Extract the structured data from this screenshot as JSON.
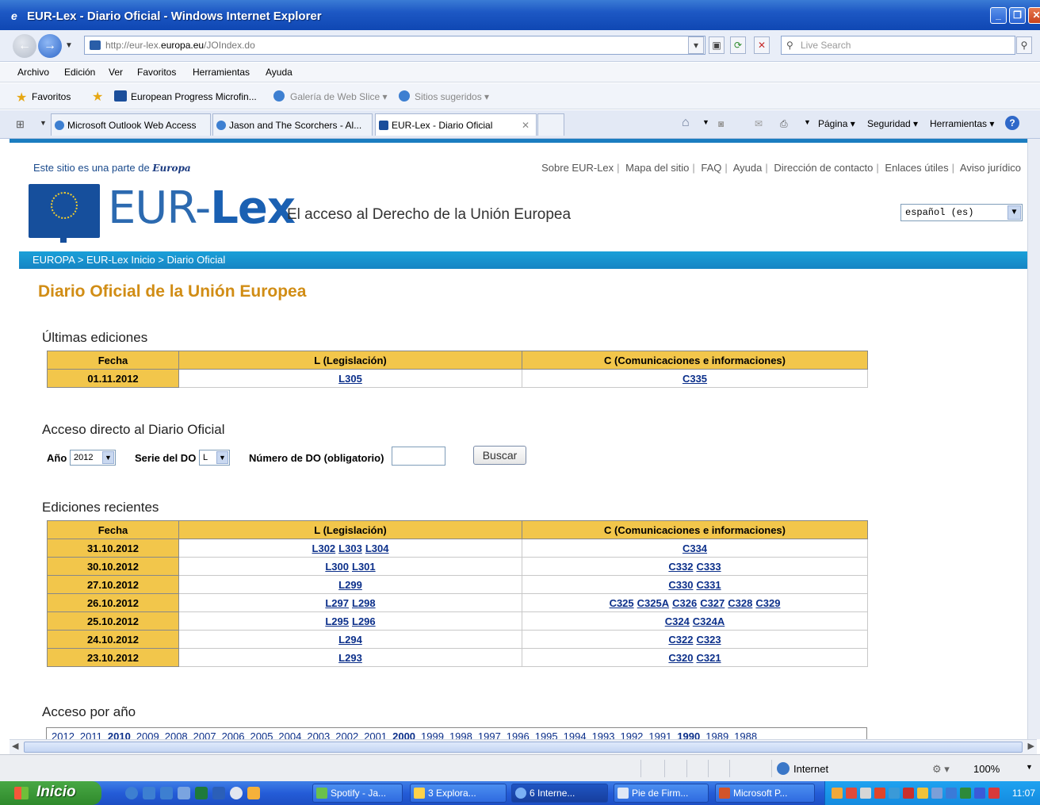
{
  "window": {
    "title": "EUR-Lex - Diario Oficial - Windows Internet Explorer"
  },
  "address": {
    "url_prefix": "http://eur-lex.",
    "url_domain": "europa.eu",
    "url_path": "/JOIndex.do",
    "search_placeholder": "Live Search"
  },
  "menu": [
    "Archivo",
    "Edición",
    "Ver",
    "Favoritos",
    "Herramientas",
    "Ayuda"
  ],
  "favorites": {
    "label": "Favoritos",
    "items": [
      "European Progress Microfin...",
      "Galería de Web Slice ▾",
      "Sitios sugeridos ▾"
    ]
  },
  "tabs": [
    {
      "label": "Microsoft Outlook Web Access"
    },
    {
      "label": "Jason and The Scorchers - Al..."
    },
    {
      "label": "EUR-Lex - Diario Oficial"
    }
  ],
  "commandbar": {
    "pagina": "Página ▾",
    "seguridad": "Seguridad ▾",
    "herramientas": "Herramientas ▾"
  },
  "site": {
    "partof": "Este sitio es una parte de",
    "partof_logo": "Europa",
    "toplinks": [
      "Sobre EUR-Lex",
      "Mapa del sitio",
      "FAQ",
      "Ayuda",
      "Dirección de contacto",
      "Enlaces útiles",
      "Aviso jurídico"
    ],
    "logo_thin": "EUR-",
    "logo_bold": "Lex",
    "tagline": "El acceso al Derecho de la Unión Europea",
    "language": "español (es)",
    "breadcrumb": "EUROPA > EUR-Lex Inicio > Diario Oficial"
  },
  "main": {
    "title": "Diario Oficial de la Unión Europea",
    "latest": {
      "heading": "Últimas ediciones",
      "headers": [
        "Fecha",
        "L (Legislación)",
        "C (Comunicaciones e informaciones)"
      ],
      "date": "01.11.2012",
      "l": "L305",
      "c": "C335"
    },
    "direct": {
      "heading": "Acceso directo al Diario Oficial",
      "year_label": "Año",
      "year_value": "2012",
      "series_label": "Serie del DO",
      "series_value": "L",
      "number_label": "Número de DO (obligatorio)",
      "number_value": "",
      "button": "Buscar"
    },
    "recent": {
      "heading": "Ediciones recientes",
      "headers": [
        "Fecha",
        "L (Legislación)",
        "C (Comunicaciones e informaciones)"
      ],
      "rows": [
        {
          "date": "31.10.2012",
          "l": [
            "L302",
            "L303",
            "L304"
          ],
          "c": [
            "C334"
          ]
        },
        {
          "date": "30.10.2012",
          "l": [
            "L300",
            "L301"
          ],
          "c": [
            "C332",
            "C333"
          ]
        },
        {
          "date": "27.10.2012",
          "l": [
            "L299"
          ],
          "c": [
            "C330",
            "C331"
          ]
        },
        {
          "date": "26.10.2012",
          "l": [
            "L297",
            "L298"
          ],
          "c": [
            "C325",
            "C325A",
            "C326",
            "C327",
            "C328",
            "C329"
          ]
        },
        {
          "date": "25.10.2012",
          "l": [
            "L295",
            "L296"
          ],
          "c": [
            "C324",
            "C324A"
          ]
        },
        {
          "date": "24.10.2012",
          "l": [
            "L294"
          ],
          "c": [
            "C322",
            "C323"
          ]
        },
        {
          "date": "23.10.2012",
          "l": [
            "L293"
          ],
          "c": [
            "C320",
            "C321"
          ]
        }
      ]
    },
    "years": {
      "heading": "Acceso por año",
      "list": [
        "2012",
        "2011",
        "2010",
        "2009",
        "2008",
        "2007",
        "2006",
        "2005",
        "2004",
        "2003",
        "2002",
        "2001",
        "2000",
        "1999",
        "1998",
        "1997",
        "1996",
        "1995",
        "1994",
        "1993",
        "1992",
        "1991",
        "1990",
        "1989",
        "1988"
      ],
      "bold": [
        "2010",
        "2000",
        "1990"
      ]
    }
  },
  "status": {
    "zone": "Internet",
    "zoom": "100%"
  },
  "taskbar": {
    "start": "Inicio",
    "tasks": [
      "Spotify - Ja...",
      "3 Explora...",
      "6 Interne...",
      "Pie de Firm...",
      "Microsoft P..."
    ],
    "clock": "11:07"
  }
}
